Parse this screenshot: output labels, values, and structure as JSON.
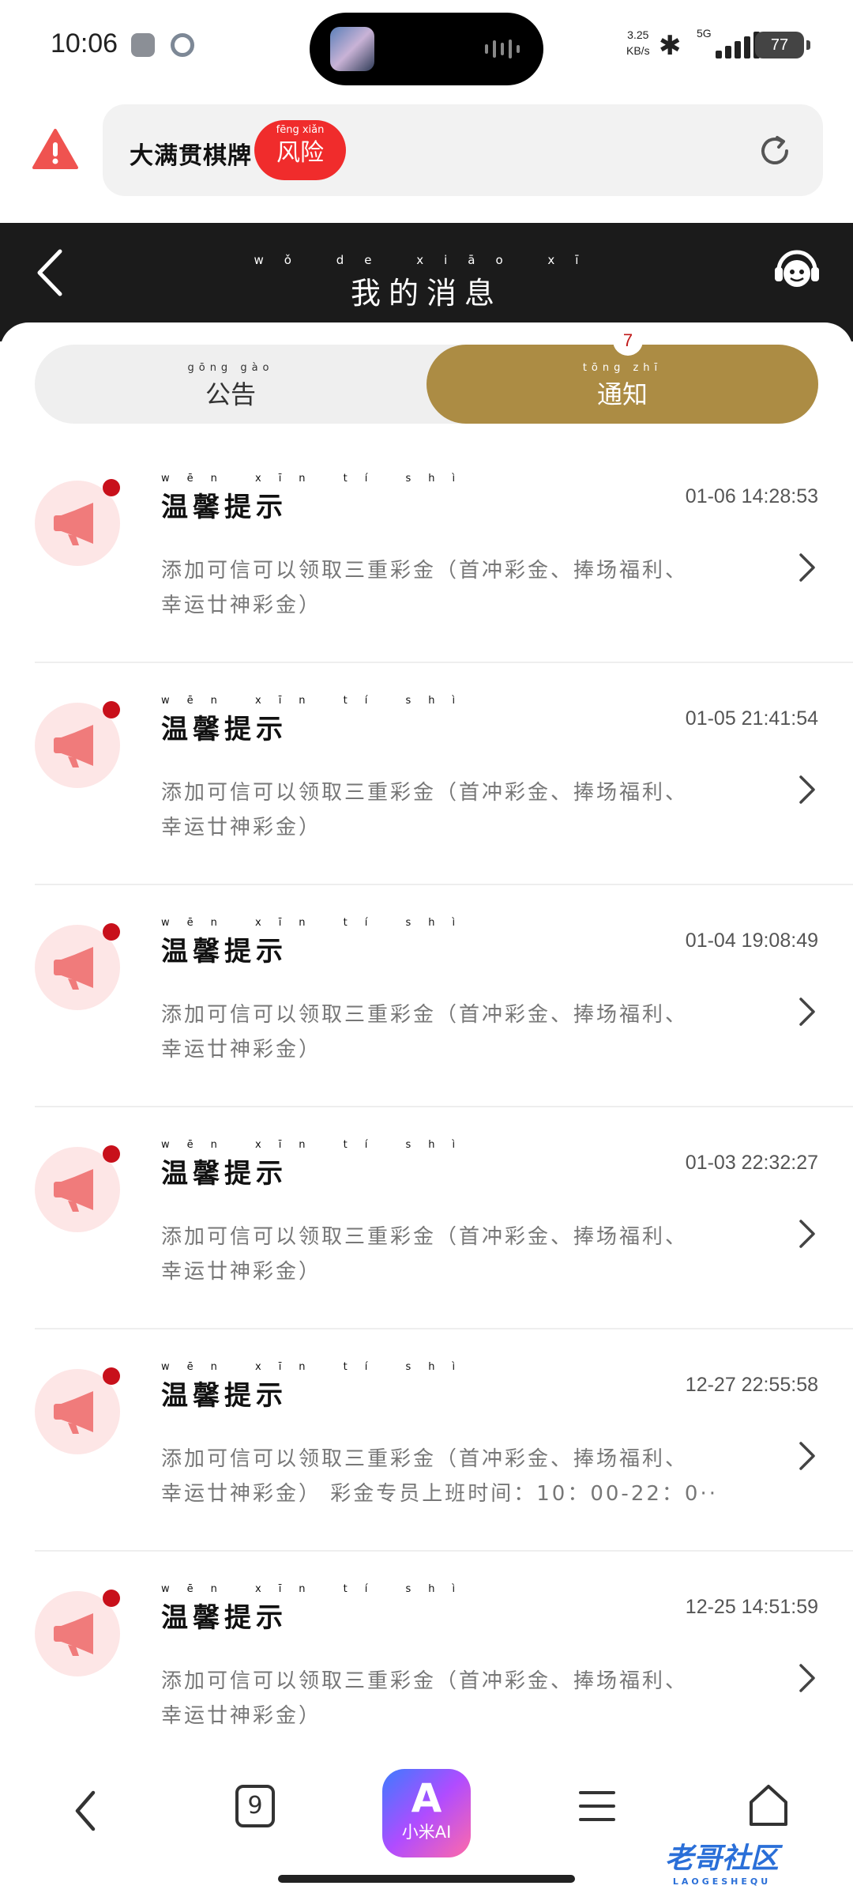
{
  "status_bar": {
    "time": "10:06",
    "speed_value": "3.25",
    "speed_unit": "KB/s",
    "network": "5G",
    "battery": "77"
  },
  "address_bar": {
    "site_name": "大满贯棋牌",
    "risk_label": "风险",
    "risk_pinyin": "fēng xiǎn",
    "icons": {
      "warning": "warning-triangle-icon",
      "refresh": "refresh-icon"
    },
    "risk_color": "#f02c2c"
  },
  "header": {
    "title": "我的消息",
    "title_pinyin": "wǒ de xiāo xī",
    "icons": {
      "back": "back-arrow-icon",
      "support": "customer-service-icon"
    }
  },
  "tabs": [
    {
      "label": "公告",
      "pinyin": "gōng gào",
      "active": false
    },
    {
      "label": "通知",
      "pinyin": "tōng zhī",
      "active": true,
      "badge": "7"
    }
  ],
  "accent_color": "#ac8c44",
  "messages": [
    {
      "title": "温馨提示",
      "title_pinyin": "wēn xīn tí shì",
      "time": "01-06 14:28:53",
      "line1": "添加可信可以领取三重彩金（首冲彩金、捧场福利、",
      "line2": "幸运廿神彩金）",
      "unread": true
    },
    {
      "title": "温馨提示",
      "title_pinyin": "wēn xīn tí shì",
      "time": "01-05 21:41:54",
      "line1": "添加可信可以领取三重彩金（首冲彩金、捧场福利、",
      "line2": "幸运廿神彩金）",
      "unread": true
    },
    {
      "title": "温馨提示",
      "title_pinyin": "wēn xīn tí shì",
      "time": "01-04 19:08:49",
      "line1": "添加可信可以领取三重彩金（首冲彩金、捧场福利、",
      "line2": "幸运廿神彩金）",
      "unread": true
    },
    {
      "title": "温馨提示",
      "title_pinyin": "wēn xīn tí shì",
      "time": "01-03 22:32:27",
      "line1": "添加可信可以领取三重彩金（首冲彩金、捧场福利、",
      "line2": "幸运廿神彩金）",
      "unread": true
    },
    {
      "title": "温馨提示",
      "title_pinyin": "wēn xīn tí shì",
      "time": "12-27 22:55:58",
      "line1": "添加可信可以领取三重彩金（首冲彩金、捧场福利、",
      "line2": "幸运廿神彩金） 彩金专员上班时间：10：00-22：0···",
      "unread": true
    },
    {
      "title": "温馨提示",
      "title_pinyin": "wēn xīn tí shì",
      "time": "12-25 14:51:59",
      "line1": "添加可信可以领取三重彩金（首冲彩金、捧场福利、",
      "line2": "幸运廿神彩金）",
      "unread": true
    }
  ],
  "bottom_bar": {
    "tab_count": "9",
    "ai_label": "小米AI",
    "ai_logo": "A",
    "icons": {
      "back": "back-icon",
      "menu": "menu-icon",
      "home": "home-icon"
    },
    "watermark": "老哥社区",
    "watermark_sub": "LAOGESHEQU"
  }
}
